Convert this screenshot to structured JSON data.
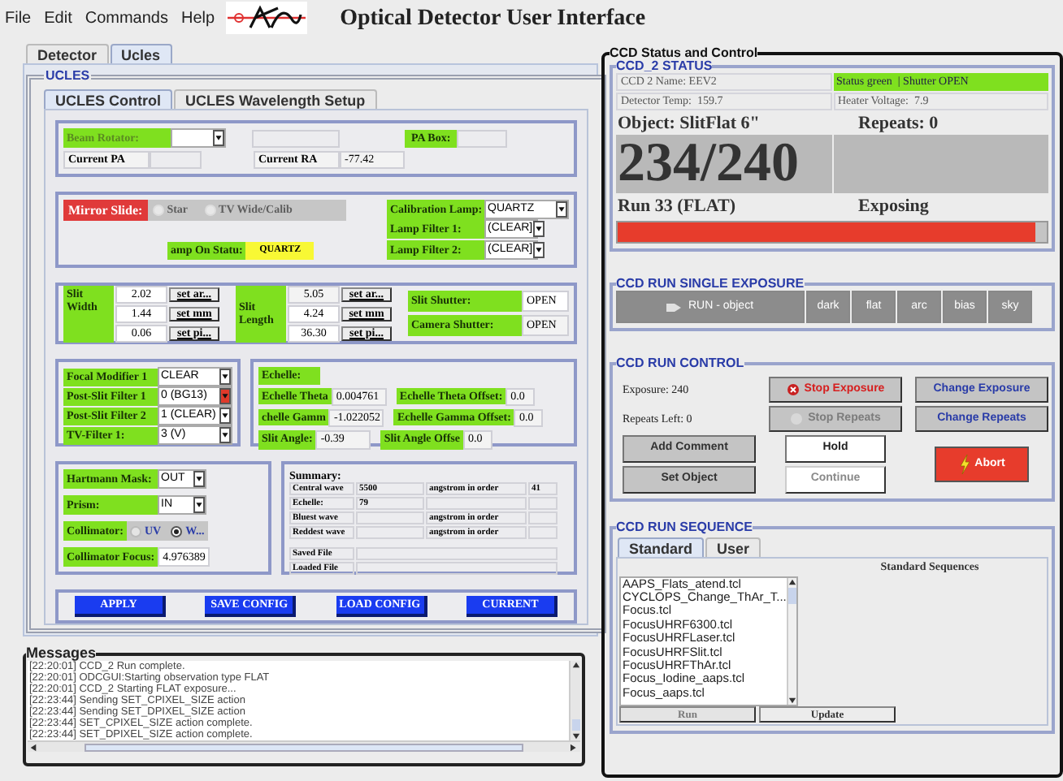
{
  "menu": [
    {
      "label": "File"
    },
    {
      "label": "Edit"
    },
    {
      "label": "Commands"
    },
    {
      "label": "Help"
    }
  ],
  "app_title": "Optical Detector User Interface",
  "main_tabs": [
    {
      "label": "Detector",
      "selected": false
    },
    {
      "label": "Ucles",
      "selected": true
    }
  ],
  "ucles": {
    "title": "UCLES",
    "tabs": [
      {
        "label": "UCLES Control",
        "selected": true
      },
      {
        "label": "UCLES Wavelength Setup",
        "selected": false
      }
    ],
    "rotator": {
      "label": "Beam Rotator:",
      "disabled": true,
      "pa_label": "PA Box:",
      "current_pa_label": "Current PA",
      "current_ra_label": "Current RA",
      "current_ra": "-77.42"
    },
    "mirror_slide": {
      "label": "Mirror Slide:",
      "options": [
        {
          "label": "Star",
          "selected": false,
          "disabled": true
        },
        {
          "label": "TV Wide/Calib",
          "selected": false,
          "disabled": true
        }
      ]
    },
    "lamps": [
      {
        "label": "Calibration Lamp:",
        "value": "QUARTZ"
      },
      {
        "label": "Lamp Filter 1:",
        "value": "(CLEAR]"
      },
      {
        "label": "Lamp Filter 2:",
        "value": "(CLEAR]"
      }
    ],
    "lamp_status": {
      "label": "amp On Statu:",
      "value": "QUARTZ"
    },
    "slits": [
      {
        "label": "Slit Width",
        "rows": [
          {
            "value": "2.02",
            "button": "set ar...",
            "highlighted": false
          },
          {
            "value": "1.44",
            "button": "set mm",
            "highlighted": false
          },
          {
            "value": "0.06",
            "button": "set pi...",
            "highlighted": false
          }
        ]
      },
      {
        "label": "Slit Length",
        "rows": [
          {
            "value": "5.05",
            "button": "set ar...",
            "highlighted": true
          },
          {
            "value": "4.24",
            "button": "set mm",
            "highlighted": false
          },
          {
            "value": "36.30",
            "button": "set pi...",
            "highlighted": false
          }
        ]
      }
    ],
    "shutters": [
      {
        "label": "Slit Shutter:",
        "value": "OPEN"
      },
      {
        "label": "Camera Shutter:",
        "value": "OPEN"
      }
    ],
    "filters": [
      {
        "label": "Focal Modifier 1",
        "value": "CLEAR",
        "alert": false
      },
      {
        "label": "Post-Slit Filter 1",
        "value": "0 (BG13)",
        "alert": true
      },
      {
        "label": "Post-Slit Filter 2",
        "value": "1 (CLEAR)",
        "alert": false
      },
      {
        "label": "TV-Filter 1:",
        "value": "3 (V)",
        "alert": false
      }
    ],
    "echelle": {
      "label": "Echelle:",
      "rows": [
        {
          "kind": "small",
          "fields": [
            {
              "label": "Echelle Theta",
              "value": "0.004761"
            },
            {
              "label": "Echelle Theta Offset:",
              "value": "0.0"
            }
          ]
        },
        {
          "kind": "small",
          "fields": [
            {
              "label": "chelle Gamm",
              "value": "-1.022052"
            },
            {
              "label": "Echelle Gamma Offset:",
              "value": "0.0"
            }
          ]
        },
        {
          "kind": "large",
          "fields": [
            {
              "label": "Slit Angle:",
              "value": "-0.39"
            },
            {
              "label": "Slit Angle Offse",
              "value": "0.0"
            }
          ]
        }
      ]
    },
    "optics": [
      {
        "kind": "dropdown",
        "label": "Hartmann Mask:",
        "value": "OUT"
      },
      {
        "kind": "dropdown",
        "label": "Prism:",
        "value": "IN"
      },
      {
        "kind": "radio",
        "label": "Collimator:",
        "options": [
          {
            "label": "UV",
            "selected": false
          },
          {
            "label": "W...",
            "selected": true
          }
        ]
      },
      {
        "kind": "field",
        "label": "Collimator Focus:",
        "value": "4.976389"
      }
    ],
    "summary": {
      "title": "Summary:",
      "rows": [
        {
          "label": "Central wave",
          "value": "5500",
          "unit": "angstrom in order",
          "order": "41"
        },
        {
          "label": "Echelle:",
          "value": "79"
        },
        {
          "label": "Bluest wave",
          "unit": "angstrom in order"
        },
        {
          "label": "Reddest wave",
          "unit": "angstrom in order"
        }
      ],
      "files": [
        {
          "label": "Saved File"
        },
        {
          "label": "Loaded File"
        }
      ]
    },
    "actions": [
      {
        "label": "APPLY"
      },
      {
        "label": "SAVE CONFIG"
      },
      {
        "label": "LOAD CONFIG"
      },
      {
        "label": "CURRENT"
      }
    ]
  },
  "messages": {
    "title": "Messages",
    "lines": [
      "[22:20:01] CCD_2 Run complete.",
      "[22:20:01] ODCGUI:Starting observation type FLAT",
      "[22:20:01] CCD_2 Starting FLAT exposure...",
      "[22:23:44] Sending SET_CPIXEL_SIZE action",
      "[22:23:44] Sending SET_DPIXEL_SIZE action",
      "[22:23:44] SET_CPIXEL_SIZE action complete.",
      "[22:23:44] SET_DPIXEL_SIZE action complete."
    ]
  },
  "ccd": {
    "title": "CCD Status and Control",
    "status": {
      "title": "CCD_2 STATUS",
      "name": "CCD 2 Name: EEV2",
      "state": "Status green  | Shutter OPEN",
      "temp": "Detector Temp:  159.7",
      "heater": "Heater Voltage:  7.9",
      "object": "Object: SlitFlat 6\"",
      "repeats": "Repeats: 0",
      "counter": "234/240",
      "run": "Run 33 (FLAT)",
      "phase": "Exposing",
      "progress": {
        "level": 0.975
      }
    },
    "single_exposure": {
      "title": "CCD RUN SINGLE EXPOSURE",
      "buttons": [
        {
          "kind": "run",
          "label": "RUN - object",
          "disabled": true
        },
        {
          "kind": "plain",
          "label": "dark",
          "disabled": true
        },
        {
          "kind": "plain",
          "label": "flat",
          "disabled": true
        },
        {
          "kind": "plain",
          "label": "arc",
          "disabled": true
        },
        {
          "kind": "plain",
          "label": "bias",
          "disabled": true
        },
        {
          "kind": "plain",
          "label": "sky",
          "disabled": true
        }
      ]
    },
    "run_control": {
      "title": "CCD RUN CONTROL",
      "exposure": "Exposure: 240",
      "repeats_left": "Repeats Left: 0",
      "stop_buttons": [
        {
          "label": "Stop Exposure",
          "disabled": false
        },
        {
          "label": "Stop Repeats",
          "disabled": true
        }
      ],
      "change_buttons": [
        {
          "label": "Change Exposure"
        },
        {
          "label": "Change Repeats"
        }
      ],
      "left_buttons": [
        {
          "label": "Add Comment"
        },
        {
          "label": "Set Object"
        }
      ],
      "hold_buttons": [
        {
          "label": "Hold",
          "disabled": false
        },
        {
          "label": "Continue",
          "disabled": true
        }
      ],
      "abort": {
        "label": "Abort"
      }
    },
    "sequence": {
      "title": "CCD RUN SEQUENCE",
      "tabs": [
        {
          "label": "Standard",
          "selected": true
        },
        {
          "label": "User",
          "selected": false
        }
      ],
      "list_title": "Standard Sequences",
      "items": [
        "AAPS_Flats_atend.tcl",
        "CYCLOPS_Change_ThAr_T...",
        "Focus.tcl",
        "FocusUHRF6300.tcl",
        "FocusUHRFLaser.tcl",
        "FocusUHRFSlit.tcl",
        "FocusUHRFThAr.tcl",
        "Focus_Iodine_aaps.tcl",
        "Focus_aaps.tcl"
      ],
      "buttons": [
        {
          "label": "Run",
          "disabled": true
        },
        {
          "label": "Update",
          "disabled": false
        }
      ]
    }
  }
}
